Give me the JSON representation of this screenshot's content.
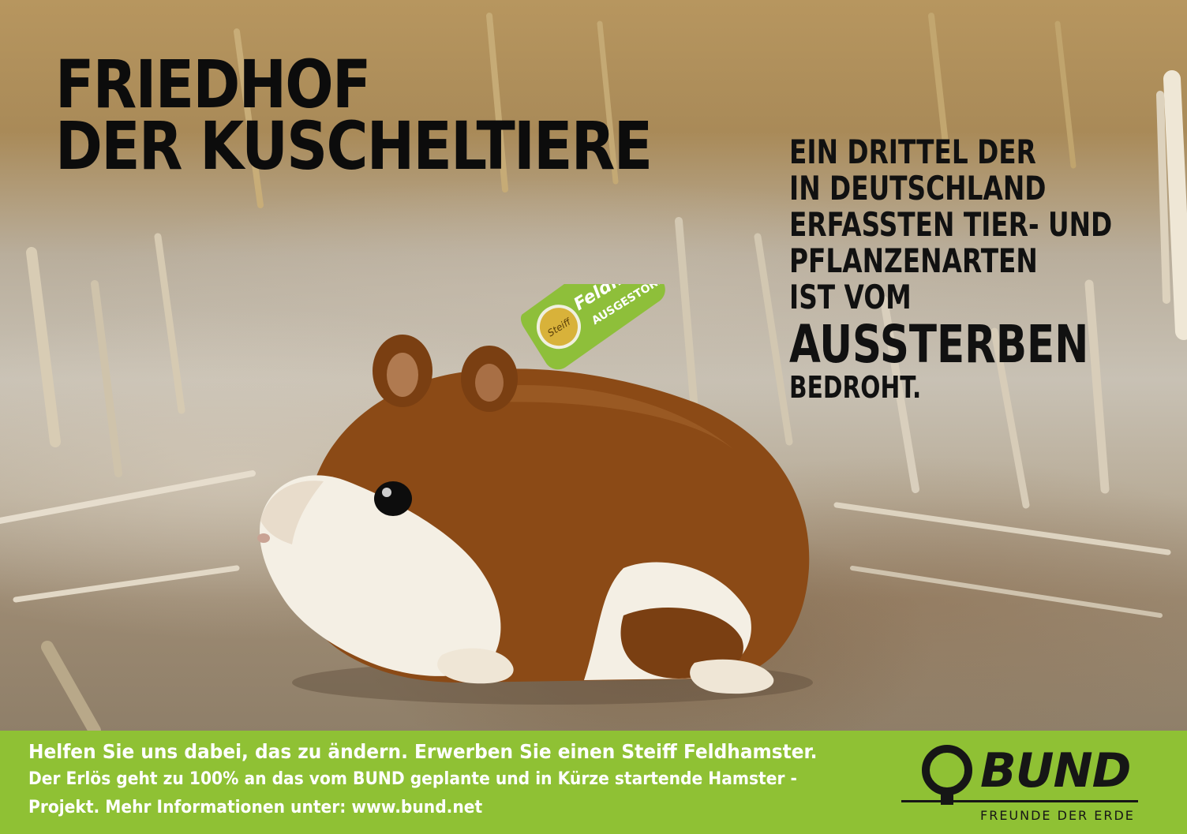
{
  "headline": {
    "line1": "FRIEDHOF",
    "line2": "DER KUSCHELTIERE"
  },
  "side_text": {
    "lines": [
      "EIN DRITTEL DER",
      "IN DEUTSCHLAND",
      "ERFASSTEN TIER- UND",
      "PFLANZENARTEN",
      "IST VOM"
    ],
    "emphasis": "AUSSTERBEN",
    "end": "BEDROHT."
  },
  "tag": {
    "title": "Feldhamster",
    "subtitle": "AUSGESTORBEN",
    "registered": "®",
    "badge": "Steiff"
  },
  "footer": {
    "lead": "Helfen Sie uns dabei, das zu ändern. Erwerben Sie einen Steiff Feldhamster.",
    "info": "Der Erlös geht zu 100% an das vom BUND geplante und in Kürze startende Hamster - Projekt. Mehr Informationen unter: www.bund.net"
  },
  "logo": {
    "name": "BUND",
    "tagline": "FREUNDE DER ERDE"
  },
  "colors": {
    "bar_green": "#8fc134",
    "tag_green": "#8ebf3a",
    "text_dark": "#0c0c0c",
    "fur_brown": "#8b4a16",
    "fur_white": "#f4efe4"
  },
  "icons": [
    "stubble-field-photo",
    "plush-hamster-illustration",
    "bund-ring-logo-icon"
  ]
}
